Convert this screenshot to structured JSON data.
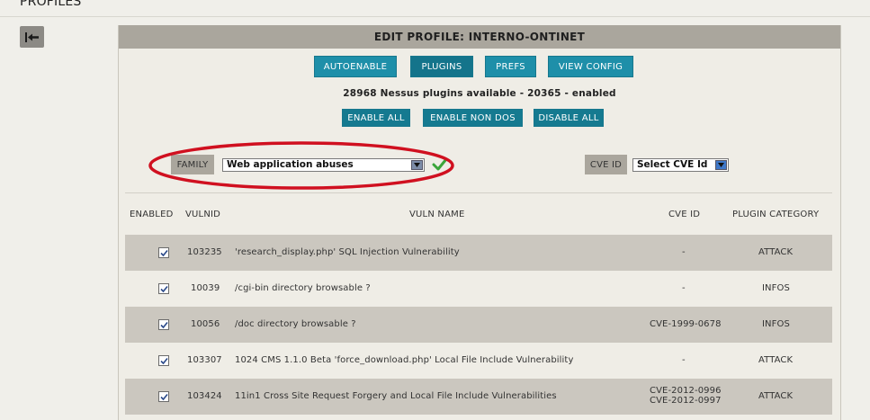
{
  "header": {
    "title": "PROFILES"
  },
  "panel": {
    "title": "EDIT PROFILE: INTERNO-ONTINET",
    "tabs": [
      {
        "label": "AUTOENABLE",
        "active": false
      },
      {
        "label": "PLUGINS",
        "active": true
      },
      {
        "label": "PREFS",
        "active": false
      },
      {
        "label": "VIEW CONFIG",
        "active": false
      }
    ],
    "plugins_info": "28968 Nessus plugins available - 20365 - enabled",
    "actions": {
      "enable_all": "ENABLE ALL",
      "enable_non_dos": "ENABLE NON DOS",
      "disable_all": "DISABLE ALL"
    },
    "filters": {
      "family_label": "FAMILY",
      "family_value": "Web application abuses",
      "cve_label": "CVE ID",
      "cve_value": "Select CVE Id"
    },
    "table": {
      "headers": {
        "enabled": "ENABLED",
        "vulnid": "VULNID",
        "vuln_name": "VULN NAME",
        "cve_id": "CVE ID",
        "plugin_category": "PLUGIN CATEGORY"
      },
      "rows": [
        {
          "enabled": true,
          "vulnid": "103235",
          "name": "'research_display.php' SQL Injection Vulnerability",
          "cve1": "-",
          "cve2": "",
          "category": "ATTACK"
        },
        {
          "enabled": true,
          "vulnid": "10039",
          "name": "/cgi-bin directory browsable ?",
          "cve1": "-",
          "cve2": "",
          "category": "INFOS"
        },
        {
          "enabled": true,
          "vulnid": "10056",
          "name": "/doc directory browsable ?",
          "cve1": "CVE-1999-0678",
          "cve2": "",
          "category": "INFOS"
        },
        {
          "enabled": true,
          "vulnid": "103307",
          "name": "1024 CMS 1.1.0 Beta 'force_download.php' Local File Include Vulnerability",
          "cve1": "-",
          "cve2": "",
          "category": "ATTACK"
        },
        {
          "enabled": true,
          "vulnid": "103424",
          "name": "11in1 Cross Site Request Forgery and Local File Include Vulnerabilities",
          "cve1": "CVE-2012-0996",
          "cve2": "CVE-2012-0997",
          "category": "ATTACK"
        }
      ]
    }
  },
  "colors": {
    "accent": "#1e8fa9",
    "panel_head": "#aaa69d",
    "shaded_row": "#cbc7bf",
    "highlight_ellipse": "#d01020",
    "check_green": "#3aa53a"
  },
  "icons": {
    "back": "back-arrow-icon",
    "check": "green-check-icon",
    "dropdown": "chevron-down-icon",
    "checkbox": "checkbox-checked-icon"
  }
}
